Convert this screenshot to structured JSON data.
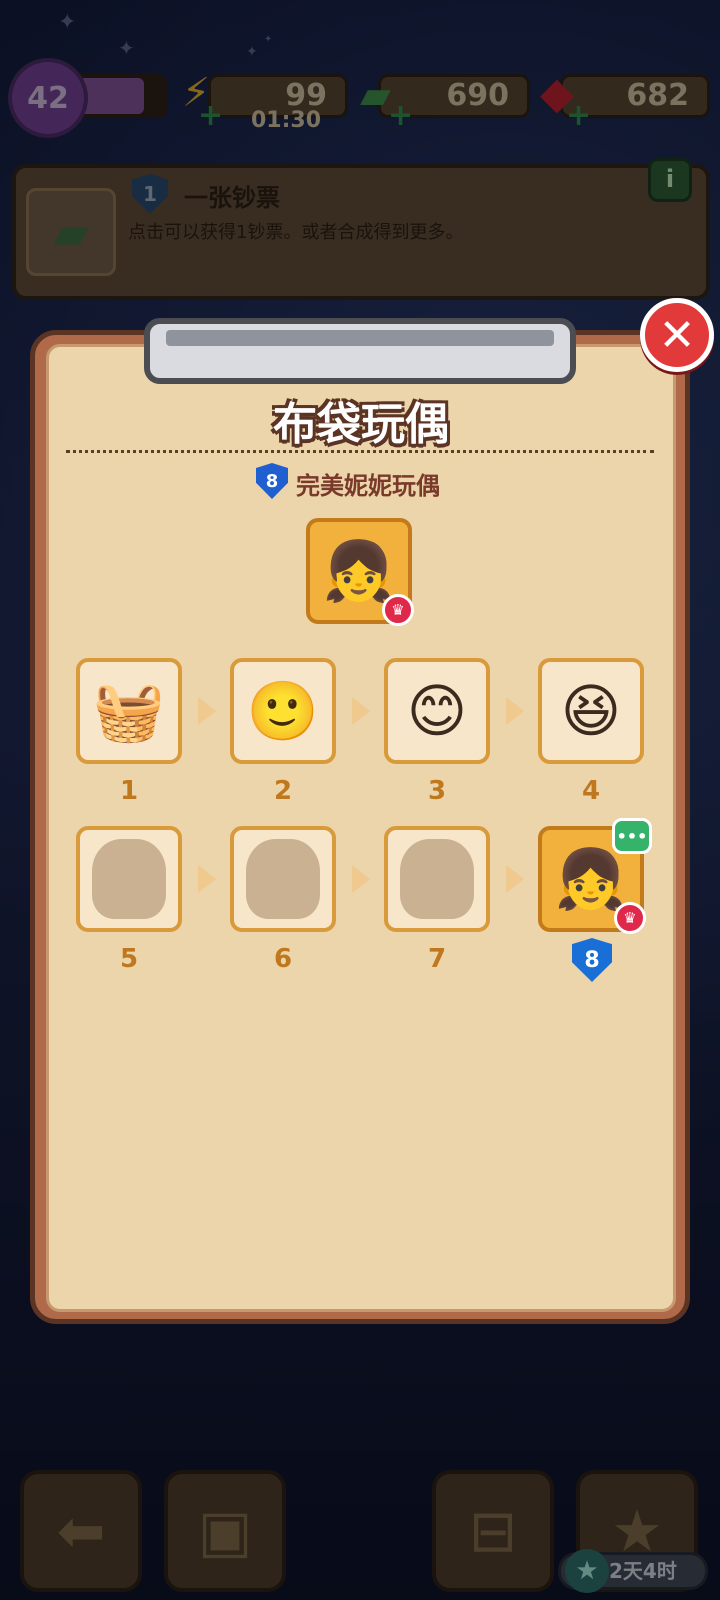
{
  "top_bar": {
    "level": "42",
    "xp_fraction": 0.8,
    "energy": "99",
    "energy_timer": "01:30",
    "cash": "690",
    "gems": "682",
    "icons": {
      "energy": "lightning-icon",
      "cash": "banknotes-icon",
      "gems": "ruby-icon",
      "add": "plus-icon"
    }
  },
  "info_card": {
    "level": "1",
    "title": "一张钞票",
    "description": "点击可以获得1钞票。或者合成得到更多。",
    "info_button": "i"
  },
  "modal": {
    "title": "布袋玩偶",
    "final_level": "8",
    "final_name": "完美妮妮玩偶",
    "close_symbol": "✕",
    "steps": [
      {
        "label": "1",
        "state": "unlocked",
        "icon": "🧺"
      },
      {
        "label": "2",
        "state": "unlocked",
        "icon": "🙂"
      },
      {
        "label": "3",
        "state": "unlocked",
        "icon": "😊"
      },
      {
        "label": "4",
        "state": "unlocked",
        "icon": "😆"
      },
      {
        "label": "5",
        "state": "locked"
      },
      {
        "label": "6",
        "state": "locked"
      },
      {
        "label": "7",
        "state": "locked"
      },
      {
        "label": "8",
        "state": "final",
        "icon": "👧"
      }
    ],
    "crown_symbol": "♛",
    "more_symbol": "•••"
  },
  "bottom_bar": {
    "timer": "2天4时",
    "icons": [
      "back-arrow-icon",
      "backpack-icon",
      "basket-icon",
      "clipboard-star-icon"
    ]
  },
  "colors": {
    "accent_red": "#e23a3a",
    "paper": "#ecd4ab",
    "tile_border": "#d89a3a",
    "shield_blue": "#1f5fd0"
  }
}
